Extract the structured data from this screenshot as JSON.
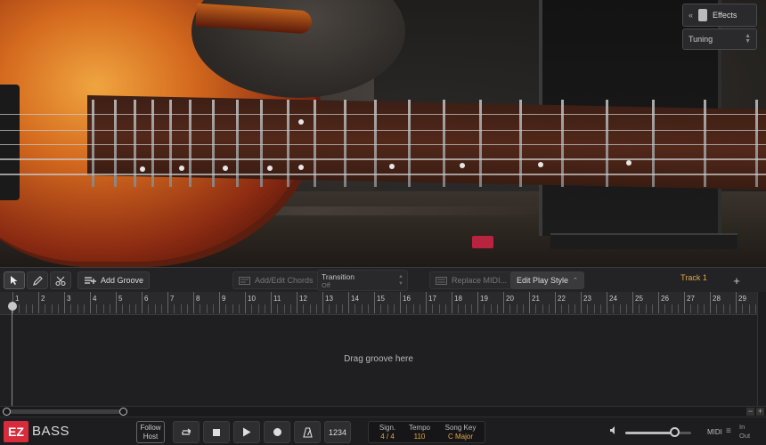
{
  "scene": {
    "effects_label": "Effects",
    "effects_arrow": "«",
    "tuning_label": "Tuning",
    "tuning_arrow": "⌃⌄"
  },
  "toolbar": {
    "select_tool_icon": "select-arrow",
    "pencil_tool_icon": "pencil",
    "scissors_tool_icon": "scissors",
    "add_groove_label": "Add Groove",
    "add_edit_chords_label": "Add/Edit Chords",
    "transition_label": "Transition",
    "transition_value": "Off",
    "replace_midi_label": "Replace MIDI...",
    "edit_play_style_label": "Edit Play Style",
    "track_label": "Track 1",
    "add_track_label": "+"
  },
  "timeline": {
    "bars": [
      "1",
      "2",
      "3",
      "4",
      "5",
      "6",
      "7",
      "8",
      "9",
      "10",
      "11",
      "12",
      "13",
      "14",
      "15",
      "16",
      "17",
      "18",
      "19",
      "20",
      "21",
      "22",
      "23",
      "24",
      "25",
      "26",
      "27",
      "28",
      "29"
    ],
    "drop_hint": "Drag groove here",
    "zoom_minus": "−",
    "zoom_plus": "+"
  },
  "transport": {
    "logo_ez": "EZ",
    "logo_bass": "BASS",
    "follow_host_line1": "Follow",
    "follow_host_line2": "Host",
    "count_in_label": "1234",
    "signature_label": "Sign.",
    "signature_value": "4 / 4",
    "tempo_label": "Tempo",
    "tempo_value": "110",
    "song_key_label": "Song Key",
    "song_key_value": "C Major",
    "volume_level": 0.75,
    "midi_label": "MIDI",
    "in_label": "In",
    "out_label": "Out"
  },
  "colors": {
    "accent_orange": "#e0a843",
    "logo_red": "#d62c3c"
  }
}
